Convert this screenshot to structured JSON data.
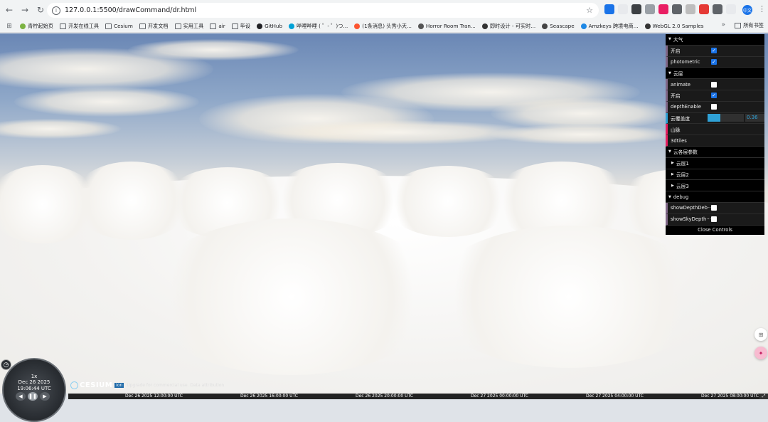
{
  "browser": {
    "url": "127.0.0.1:5500/drawCommand/dr.html",
    "extensions": [
      "extension-1",
      "extension-2",
      "extension-3",
      "extension-4",
      "extension-5",
      "extension-6",
      "extension-7",
      "extension-8",
      "extension-9",
      "extension-10"
    ],
    "profile_label": "中文"
  },
  "bookmarks": [
    {
      "label": "青柠起始页",
      "type": "favicon",
      "color": "#7cb342"
    },
    {
      "label": "开发在线工具",
      "type": "folder"
    },
    {
      "label": "Cesium",
      "type": "folder"
    },
    {
      "label": "开发文档",
      "type": "folder"
    },
    {
      "label": "实用工具",
      "type": "folder"
    },
    {
      "label": "air",
      "type": "folder"
    },
    {
      "label": "毕设",
      "type": "folder"
    },
    {
      "label": "GitHub",
      "type": "favicon",
      "color": "#202124"
    },
    {
      "label": "哔哩哔哩 ( ゜- ゜)つ...",
      "type": "favicon",
      "color": "#00a1d6"
    },
    {
      "label": "(1条消息) 头秀小天...",
      "type": "favicon",
      "color": "#fc5531"
    },
    {
      "label": "Horror Room Tran...",
      "type": "favicon",
      "color": "#555"
    },
    {
      "label": "即时设计 - 可实时...",
      "type": "favicon",
      "color": "#333"
    },
    {
      "label": "Seascape",
      "type": "favicon",
      "color": "#444"
    },
    {
      "label": "Amzkeys 跨境电商...",
      "type": "favicon",
      "color": "#1e88e5"
    },
    {
      "label": "WebGL 2.0 Samples",
      "type": "favicon",
      "color": "#333"
    }
  ],
  "bookmarks_all": "所有书签",
  "bookmarks_more": "»",
  "gui": {
    "folders": [
      {
        "label": "大气",
        "items": [
          {
            "label": "开启",
            "type": "bool",
            "checked": true
          },
          {
            "label": "photometric",
            "type": "bool",
            "checked": true
          }
        ]
      },
      {
        "label": "云层",
        "items": [
          {
            "label": "animate",
            "type": "bool",
            "checked": false
          },
          {
            "label": "开启",
            "type": "bool",
            "checked": true
          },
          {
            "label": "depthEnable",
            "type": "bool",
            "checked": false
          },
          {
            "label": "云覆盖度",
            "type": "number",
            "value": "0.36",
            "fraction": 0.36
          },
          {
            "label": "山脉",
            "type": "function"
          },
          {
            "label": "3dtiles",
            "type": "function"
          }
        ]
      }
    ],
    "params_folder": "云各层参数",
    "layers": [
      "云层1",
      "云层2",
      "云层3"
    ],
    "debug_folder": "debug",
    "debug_items": [
      {
        "label": "showDepthDeb···",
        "checked": false
      },
      {
        "label": "showSkyDepth···",
        "checked": false
      }
    ],
    "close_label": "Close Controls"
  },
  "animation": {
    "speed": "1x",
    "date": "Dec 26 2025",
    "time": "19:06:44 UTC"
  },
  "credit": {
    "logo": "CESIUM",
    "ion": "ion",
    "text": "Upgrade for commercial use. Data attribution"
  },
  "timeline": {
    "ticks": [
      "Dec 26 2025 12:00:00 UTC",
      "Dec 26 2025 16:00:00 UTC",
      "Dec 26 2025 20:00:00 UTC",
      "Dec 27 2025 00:00:00 UTC",
      "Dec 27 2025 04:00:00 UTC",
      "Dec 27 2025 08:00:00 UTC"
    ]
  }
}
